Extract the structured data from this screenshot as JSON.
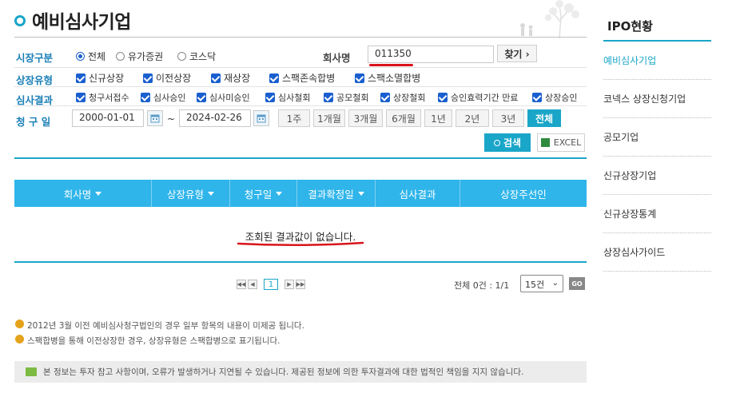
{
  "page_title": "예비심사기업",
  "filters": {
    "market_label": "시장구분",
    "market_options": [
      "전체",
      "유가증권",
      "코스닥"
    ],
    "company_label": "회사명",
    "company_value": "011350",
    "find_button": "찾기 ›",
    "listing_type_label": "상장유형",
    "listing_types": [
      "신규상장",
      "이전상장",
      "재상장",
      "스팩존속합병",
      "스팩소멸합병"
    ],
    "result_label": "심사결과",
    "results": [
      "청구서접수",
      "심사승인",
      "심사미승인",
      "심사철회",
      "공모철회",
      "상장철회",
      "승인효력기간 만료",
      "상장승인"
    ],
    "request_date_label": "청 구 일",
    "date_from": "2000-01-01",
    "date_sep": "~",
    "date_to": "2024-02-26",
    "period_buttons": [
      "1주",
      "1개월",
      "3개월",
      "6개월",
      "1년",
      "2년",
      "3년",
      "전체"
    ],
    "search_button": "검색",
    "excel_button": "EXCEL"
  },
  "table": {
    "columns": [
      "회사명",
      "상장유형",
      "청구일",
      "결과확정일",
      "심사결과",
      "상장주선인"
    ],
    "empty_message": "조회된 결과값이 없습니다."
  },
  "pagination": {
    "current_page": "1",
    "summary": "전체 0건 : 1/1",
    "page_size": "15건",
    "go_button": "GO"
  },
  "notes": [
    "2012년 3월 이전 예비심사청구법인의 경우 일부 항목의 내용이 미제공 됩니다.",
    "스팩합병을 통해 이전상장한 경우, 상장유형은 스팩합병으로 표기됩니다."
  ],
  "disclaimer": "본 정보는 투자 참고 사항이며, 오류가 발생하거나 지연될 수 있습니다. 제공된 정보에 의한 투자결과에 대한 법적인 책임을 지지 않습니다.",
  "sidebar": {
    "title": "IPO현황",
    "items": [
      "예비심사기업",
      "코넥스 상장신청기업",
      "공모기업",
      "신규상장기업",
      "신규상장통계",
      "상장심사가이드"
    ]
  },
  "colors": {
    "accent": "#1aa6c9",
    "header": "#2fb5ea",
    "label": "#1a7fb6",
    "underline": "#d9141b"
  }
}
